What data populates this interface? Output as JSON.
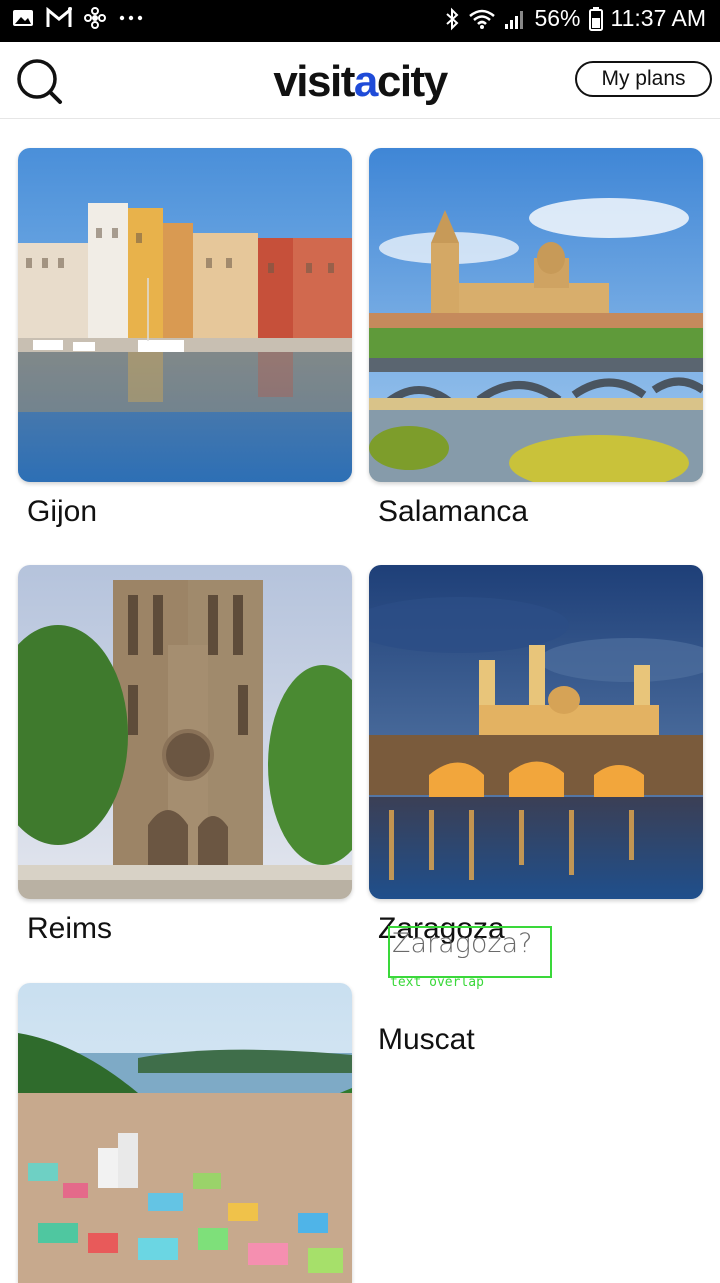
{
  "status_bar": {
    "left_icons": [
      "gallery-icon",
      "gmail-icon",
      "pinwheel-icon",
      "more-dots-icon"
    ],
    "battery": "56%",
    "time": "11:37 AM"
  },
  "header": {
    "logo_prefix": "visit",
    "logo_accent": "a",
    "logo_suffix": "city",
    "my_plans_label": "My plans",
    "accent_color": "#1f4bd8"
  },
  "cities": [
    {
      "name": "Gijon"
    },
    {
      "name": "Salamanca"
    },
    {
      "name": "Reims"
    },
    {
      "name": "Zaragoza"
    },
    {
      "name": "Muscat"
    }
  ],
  "overlay": {
    "text": "Zaragoza?",
    "label": "text overlap",
    "color": "#3ad83a"
  }
}
